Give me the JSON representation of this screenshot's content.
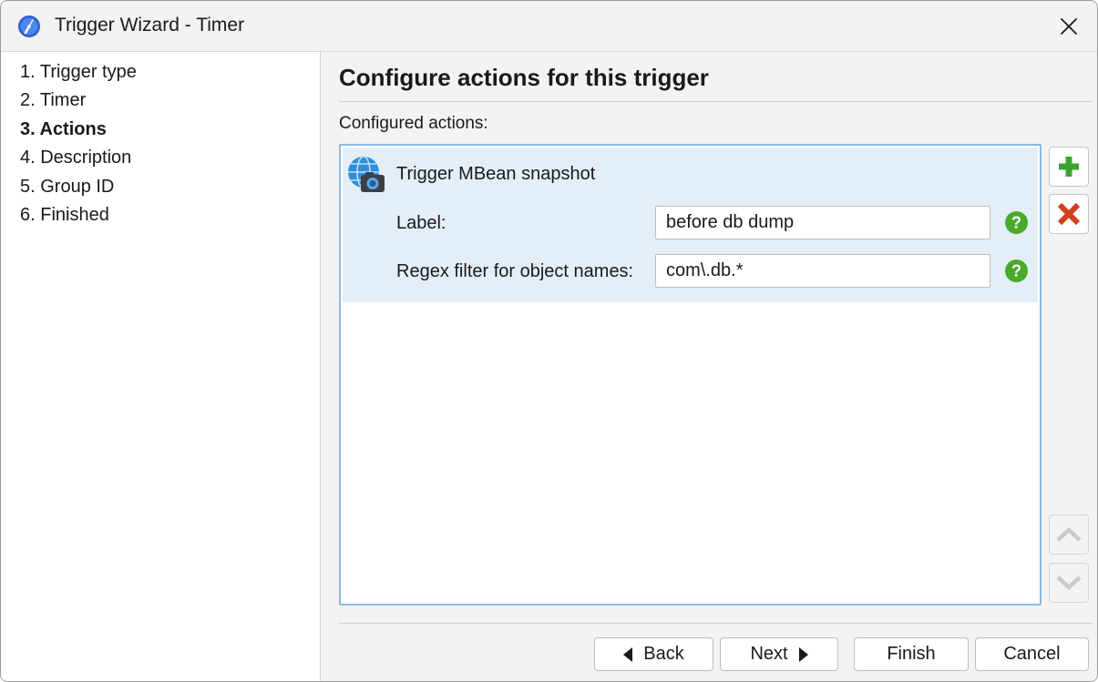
{
  "window": {
    "title": "Trigger Wizard - Timer",
    "icons": {
      "app": "stopwatch-icon",
      "close": "close-icon"
    }
  },
  "sidebar": {
    "steps": [
      {
        "label": "1. Trigger type",
        "active": false
      },
      {
        "label": "2. Timer",
        "active": false
      },
      {
        "label": "3. Actions",
        "active": true
      },
      {
        "label": "4. Description",
        "active": false
      },
      {
        "label": "5. Group ID",
        "active": false
      },
      {
        "label": "6. Finished",
        "active": false
      }
    ]
  },
  "main": {
    "heading": "Configure actions for this trigger",
    "list_label": "Configured actions:",
    "actions": [
      {
        "title": "Trigger MBean snapshot",
        "icon": "globe-camera-icon",
        "fields": [
          {
            "label": "Label:",
            "value": "before db dump"
          },
          {
            "label": "Regex filter for object names:",
            "value": "com\\.db.*"
          }
        ]
      }
    ],
    "side_buttons": {
      "add": "plus-icon",
      "remove": "delete-x-icon",
      "up": "chevron-up-icon",
      "down": "chevron-down-icon"
    }
  },
  "footer": {
    "back": "Back",
    "next": "Next",
    "finish": "Finish",
    "cancel": "Cancel"
  },
  "colors": {
    "selection_bg": "#e4eef7",
    "selection_border": "#8fb9e3",
    "add_green": "#3ea232",
    "remove_red": "#d23f1e",
    "help_green": "#4aa82c"
  }
}
